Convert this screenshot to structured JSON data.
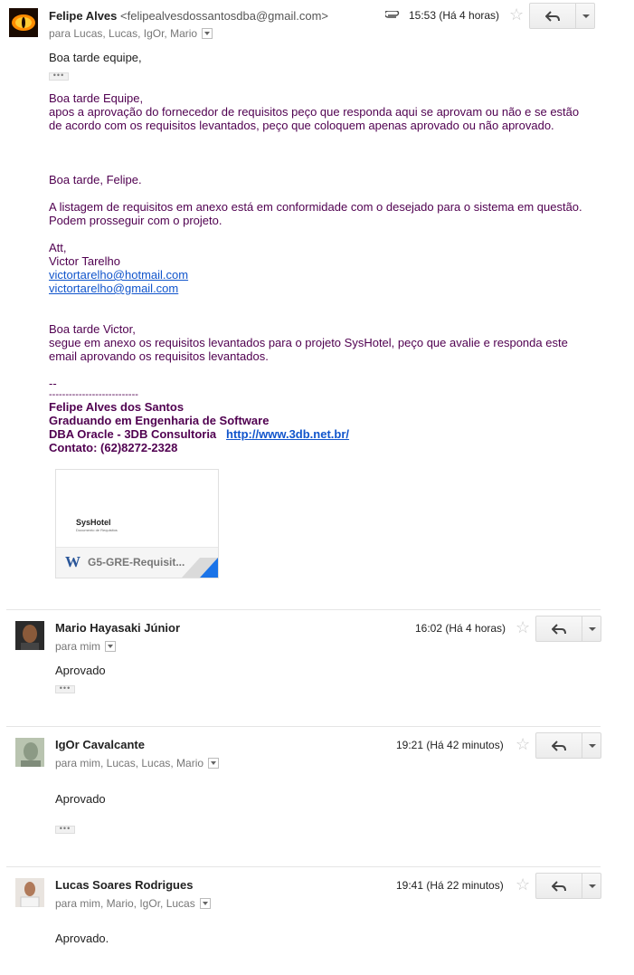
{
  "messages": [
    {
      "sender_name": "Felipe Alves",
      "sender_email": "<felipealvesdossantosdba@gmail.com>",
      "recipients": "para Lucas, Lucas, IgOr, Mario",
      "time": "15:53 (Há 4 horas)",
      "has_attachment_icon": true
    },
    {
      "sender_name": "Mario Hayasaki Júnior",
      "recipients": "para mim",
      "time": "16:02 (Há 4 horas)",
      "body": "Aprovado"
    },
    {
      "sender_name": "IgOr Cavalcante",
      "recipients": "para mim, Lucas, Lucas, Mario",
      "time": "19:21 (Há 42 minutos)",
      "body": "Aprovado"
    },
    {
      "sender_name": "Lucas Soares Rodrigues",
      "recipients": "para mim, Mario, IgOr, Lucas",
      "time": "19:41 (Há 22 minutos)",
      "body": "Aprovado."
    }
  ],
  "first_body": {
    "greeting": "Boa tarde equipe,",
    "quote1": {
      "l1": "Boa tarde Equipe,",
      "l2": "apos a aprovação do fornecedor de requisitos peço que responda aqui se aprovam ou não e se estão",
      "l3": "de acordo com os requisitos levantados, peço que coloquem apenas aprovado ou não aprovado."
    },
    "quote2": {
      "l1": "Boa tarde, Felipe.",
      "l2": "A listagem de requisitos em anexo está em conformidade com o desejado para o sistema em questão.",
      "l3": "Podem prosseguir com o projeto.",
      "l4": "Att,",
      "l5": "Victor Tarelho",
      "email1": "victortarelho@hotmail.com",
      "email2": "victortarelho@gmail.com"
    },
    "quote3": {
      "l1": "Boa tarde Victor,",
      "l2": "segue em anexo os requisitos levantados para o projeto SysHotel, peço que avalie e responda este",
      "l3": "email aprovando os requisitos levantados."
    },
    "signature": {
      "dash": "--",
      "rule": "---------------------------",
      "name": "Felipe Alves dos Santos",
      "title": "Graduando em Engenharia de Software",
      "company": "DBA Oracle - 3DB Consultoria",
      "url": "http://www.3db.net.br/",
      "contact": "Contato: (62)8272-2328"
    }
  },
  "attachment": {
    "preview_title": "SysHotel",
    "preview_subtitle": "Documento de Requisitos",
    "file_name": "G5-GRE-Requisit...",
    "file_type_letter": "W"
  },
  "colors": {
    "quoted_text": "#500050",
    "link": "#1155cc",
    "word_blue": "#2a5699"
  },
  "icons": {
    "reply": "reply-arrow-icon",
    "more": "chevron-down-icon",
    "star": "star-outline-icon",
    "attachment": "paperclip-icon",
    "details": "dropdown-arrow-icon"
  }
}
